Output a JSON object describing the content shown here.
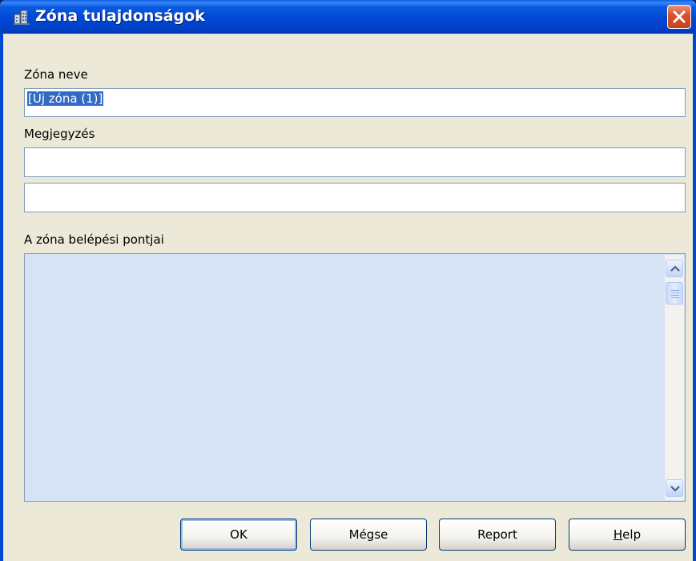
{
  "window": {
    "title": "Zóna tulajdonságok",
    "icon": "zone-properties-icon"
  },
  "form": {
    "name_label": "Zóna neve",
    "name_value": "[Új zóna (1)]",
    "comment_label": "Megjegyzés",
    "comment_line1": "",
    "comment_line2": "",
    "entry_points_label": "A zóna belépési pontjai",
    "entry_points": []
  },
  "buttons": {
    "ok": "OK",
    "cancel": "Mégse",
    "report": "Report",
    "help_mnemonic": "H",
    "help_rest": "elp"
  },
  "colors": {
    "titlebar": "#0047D4",
    "listbox_bg": "#D6E3F5",
    "selection": "#316AC5",
    "close": "#D9532D"
  }
}
